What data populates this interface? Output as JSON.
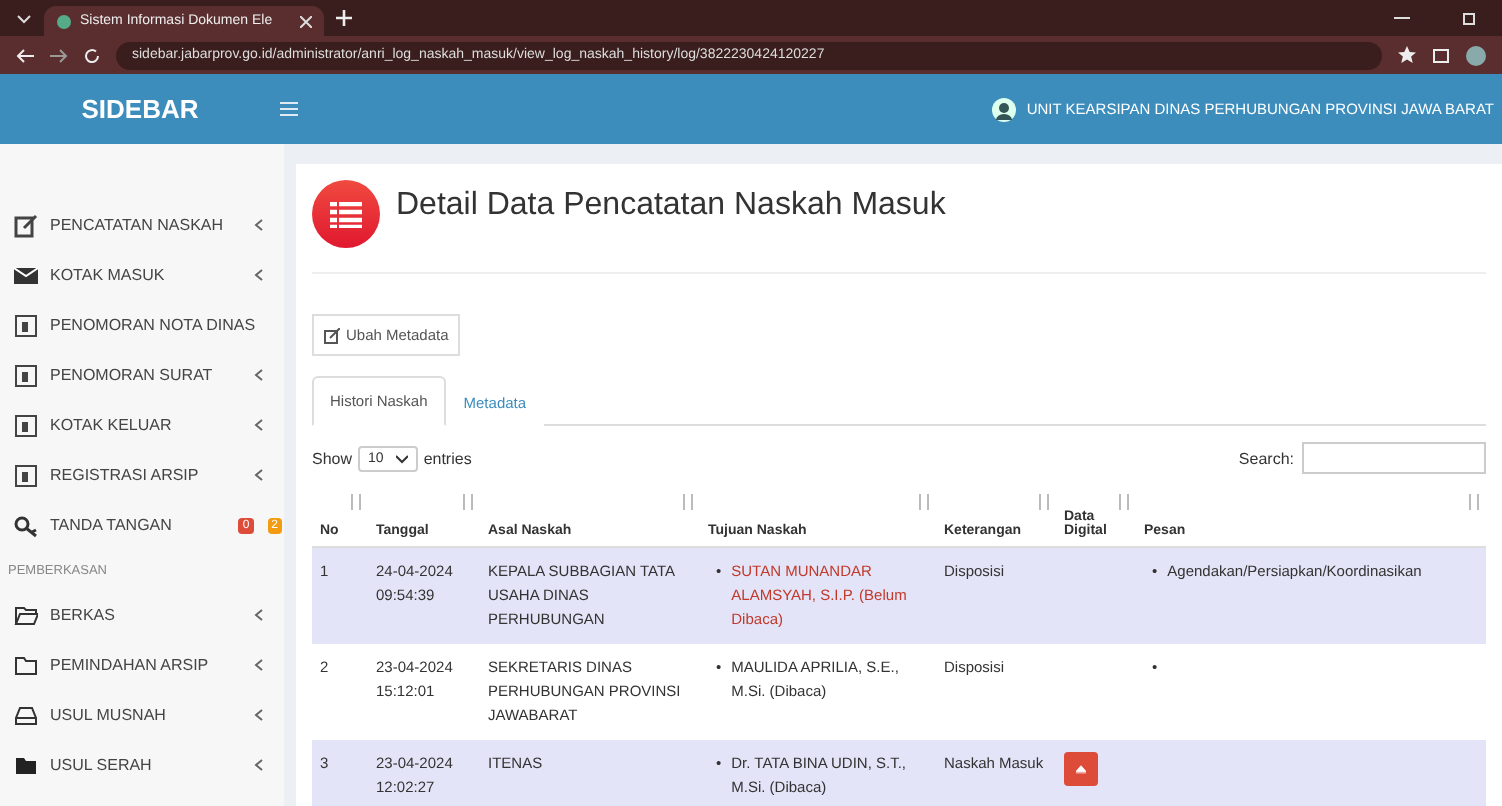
{
  "browser": {
    "tab_title": "Sistem Informasi Dokumen Ele",
    "url": "sidebar.jabarprov.go.id/administrator/anri_log_naskah_masuk/view_log_naskah_history/log/3822230424120227"
  },
  "header": {
    "brand": "SIDEBAR",
    "unit": "UNIT KEARSIPAN DINAS PERHUBUNGAN PROVINSI JAWA BARAT"
  },
  "sidebar": {
    "items": [
      {
        "kind": "edit",
        "label": "PENCATATAN NASKAH",
        "caret": true
      },
      {
        "kind": "mail",
        "label": "KOTAK MASUK",
        "caret": true
      },
      {
        "kind": "doc",
        "label": "PENOMORAN NOTA DINAS",
        "caret": false
      },
      {
        "kind": "doc",
        "label": "PENOMORAN SURAT",
        "caret": true
      },
      {
        "kind": "doc",
        "label": "KOTAK KELUAR",
        "caret": true
      },
      {
        "kind": "doc",
        "label": "REGISTRASI ARSIP",
        "caret": true
      },
      {
        "kind": "key",
        "label": "TANDA TANGAN",
        "caret": false,
        "badges": [
          {
            "text": "0",
            "color": "#dd4b39"
          },
          {
            "text": "2",
            "color": "#f39c12"
          }
        ]
      },
      {
        "kind": "header",
        "label": "PEMBERKASAN"
      },
      {
        "kind": "folder-open",
        "label": "BERKAS",
        "caret": true
      },
      {
        "kind": "folder",
        "label": "PEMINDAHAN ARSIP",
        "caret": true
      },
      {
        "kind": "drive",
        "label": "USUL MUSNAH",
        "caret": true
      },
      {
        "kind": "folder-solid",
        "label": "USUL SERAH",
        "caret": true
      }
    ]
  },
  "page": {
    "title": "Detail Data Pencatatan Naskah Masuk",
    "edit_button": "Ubah Metadata",
    "tabs": [
      {
        "label": "Histori Naskah",
        "selected": true
      },
      {
        "label": "Metadata",
        "selected": false
      }
    ],
    "show_label": "Show",
    "page_size": "10",
    "entries_label": "entries",
    "search_label": "Search:"
  },
  "table": {
    "columns": [
      "No",
      "Tanggal",
      "Asal Naskah",
      "Tujuan Naskah",
      "Keterangan",
      "Data Digital",
      "Pesan"
    ],
    "rows": [
      {
        "no": "1",
        "date": "24-04-2024 09:54:39",
        "from": "KEPALA SUBBAGIAN TATA USAHA DINAS PERHUBUNGAN",
        "to": {
          "marker": "•",
          "text": "SUTAN MUNANDAR ALAMSYAH, S.I.P. (Belum Dibaca)"
        },
        "read": false,
        "note": "Disposisi",
        "digital": false,
        "message": {
          "marker": "•",
          "text": "Agendakan/Persiapkan/Koordinasikan"
        }
      },
      {
        "no": "2",
        "date": "23-04-2024 15:12:01",
        "from": "SEKRETARIS DINAS PERHUBUNGAN PROVINSI JAWABARAT",
        "to": {
          "marker": "•",
          "text": "MAULIDA APRILIA, S.E., M.Si. (Dibaca)"
        },
        "read": true,
        "note": "Disposisi",
        "digital": false,
        "message": {
          "marker": "•"
        }
      },
      {
        "no": "3",
        "date": "23-04-2024 12:02:27",
        "from": "ITENAS",
        "to": {
          "marker": "•",
          "text": "Dr. TATA BINA UDIN, S.T., M.Si. (Dibaca)"
        },
        "read": true,
        "note": "Naskah Masuk",
        "digital": true
      }
    ]
  }
}
